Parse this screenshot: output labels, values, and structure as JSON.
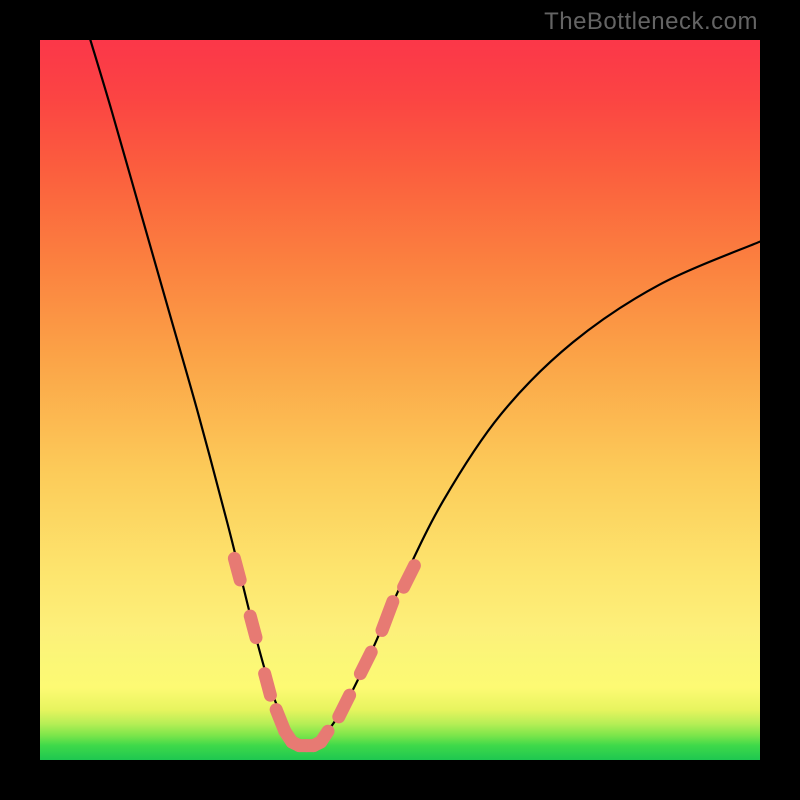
{
  "watermark": "TheBottleneck.com",
  "chart_data": {
    "type": "line",
    "title": "",
    "xlabel": "",
    "ylabel": "",
    "xlim": [
      0,
      100
    ],
    "ylim": [
      0,
      100
    ],
    "series": [
      {
        "name": "bottleneck-curve",
        "x": [
          7,
          10,
          14,
          18,
          22,
          26,
          28,
          30,
          32,
          34,
          35,
          37,
          39,
          42,
          46,
          50,
          56,
          64,
          74,
          86,
          100
        ],
        "y": [
          100,
          90,
          76,
          62,
          48,
          33,
          25,
          17,
          10,
          5,
          3,
          2,
          3,
          7,
          15,
          24,
          36,
          48,
          58,
          66,
          72
        ]
      }
    ],
    "markers": [
      {
        "series": "bottleneck-curve",
        "name": "highlight-segments",
        "style": "salmon-capsule",
        "points": [
          {
            "x": 27.0,
            "y": 28
          },
          {
            "x": 27.8,
            "y": 25
          },
          {
            "x": 29.2,
            "y": 20
          },
          {
            "x": 30.0,
            "y": 17
          },
          {
            "x": 31.2,
            "y": 12
          },
          {
            "x": 32.0,
            "y": 9
          },
          {
            "x": 32.8,
            "y": 7
          },
          {
            "x": 34.0,
            "y": 4
          },
          {
            "x": 35.0,
            "y": 2.5
          },
          {
            "x": 36.0,
            "y": 2
          },
          {
            "x": 37.0,
            "y": 2
          },
          {
            "x": 38.0,
            "y": 2
          },
          {
            "x": 39.0,
            "y": 2.5
          },
          {
            "x": 40.0,
            "y": 4
          },
          {
            "x": 41.5,
            "y": 6
          },
          {
            "x": 43.0,
            "y": 9
          },
          {
            "x": 44.5,
            "y": 12
          },
          {
            "x": 46.0,
            "y": 15
          },
          {
            "x": 47.5,
            "y": 18
          },
          {
            "x": 49.0,
            "y": 22
          },
          {
            "x": 50.5,
            "y": 24
          },
          {
            "x": 52.0,
            "y": 27
          }
        ]
      }
    ]
  }
}
